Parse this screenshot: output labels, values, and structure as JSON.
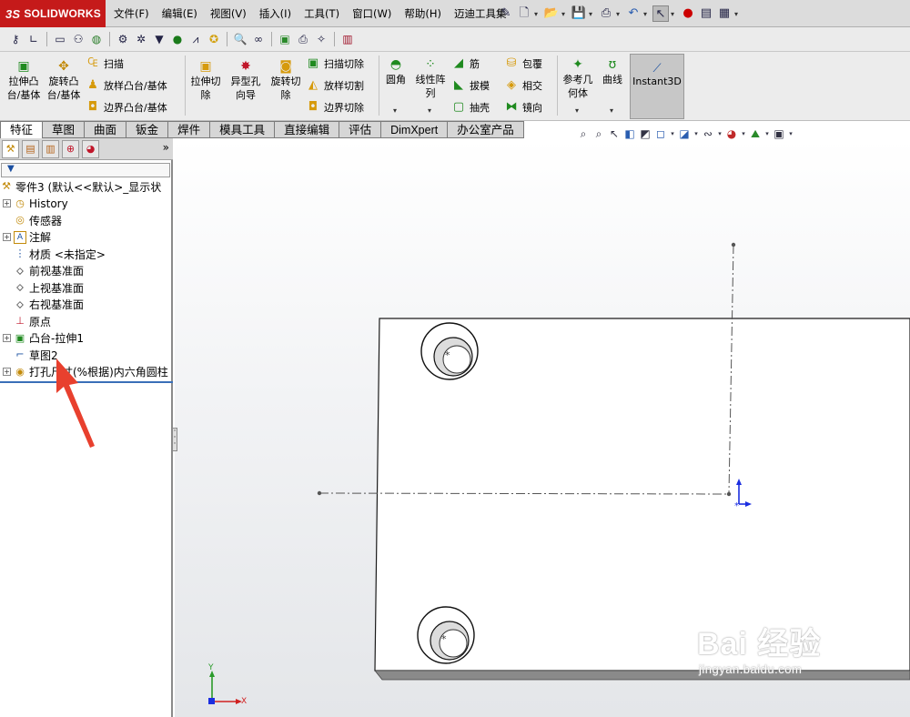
{
  "app": {
    "logo_text": "SOLIDWORKS",
    "logo_prefix": "3S"
  },
  "menu": [
    "文件(F)",
    "编辑(E)",
    "视图(V)",
    "插入(I)",
    "工具(T)",
    "窗口(W)",
    "帮助(H)",
    "迈迪工具集"
  ],
  "ribbon": {
    "extrude_boss": "拉伸凸台/基体",
    "revolve_boss": "旋转凸台/基体",
    "sweep": "扫描",
    "loft_boss": "放样凸台/基体",
    "boundary_boss": "边界凸台/基体",
    "extrude_cut": "拉伸切除",
    "hole_wizard": "异型孔向导",
    "revolve_cut": "旋转切除",
    "swept_cut": "扫描切除",
    "lofted_cut": "放样切割",
    "boundary_cut": "边界切除",
    "fillet": "圆角",
    "linear_pattern": "线性阵列",
    "rib": "筋",
    "draft": "拔模",
    "shell": "抽壳",
    "wrap": "包覆",
    "intersect": "相交",
    "mirror": "镜向",
    "ref_geometry": "参考几何体",
    "curves": "曲线",
    "instant3d": "Instant3D"
  },
  "tabs": [
    "特征",
    "草图",
    "曲面",
    "钣金",
    "焊件",
    "模具工具",
    "直接编辑",
    "评估",
    "DimXpert",
    "办公室产品"
  ],
  "active_tab": "特征",
  "tree": {
    "root": "零件3 (默认<<默认>_显示状",
    "items": [
      {
        "label": "History",
        "icon": "history-icon",
        "expand": true
      },
      {
        "label": "传感器",
        "icon": "sensor-icon",
        "expand": false
      },
      {
        "label": "注解",
        "icon": "annotation-icon",
        "expand": true
      },
      {
        "label": "材质 <未指定>",
        "icon": "material-icon",
        "expand": false
      },
      {
        "label": "前视基准面",
        "icon": "plane-icon",
        "expand": false
      },
      {
        "label": "上视基准面",
        "icon": "plane-icon",
        "expand": false
      },
      {
        "label": "右视基准面",
        "icon": "plane-icon",
        "expand": false
      },
      {
        "label": "原点",
        "icon": "origin-icon",
        "expand": false
      },
      {
        "label": "凸台-拉伸1",
        "icon": "extrude-icon",
        "expand": true
      },
      {
        "label": "草图2",
        "icon": "sketch-icon",
        "expand": false
      },
      {
        "label": "打孔尺寸(%根据)内六角圆柱",
        "icon": "hole-icon",
        "expand": true
      }
    ]
  },
  "axes": {
    "x": "X",
    "y": "Y"
  },
  "watermark": {
    "main": "Bai  经验",
    "sub": "jingyan.baidu.com"
  },
  "colors": {
    "logo_bg": "#c51a1a",
    "arrow": "#e8402e",
    "triad_blue": "#1b2ee0"
  }
}
